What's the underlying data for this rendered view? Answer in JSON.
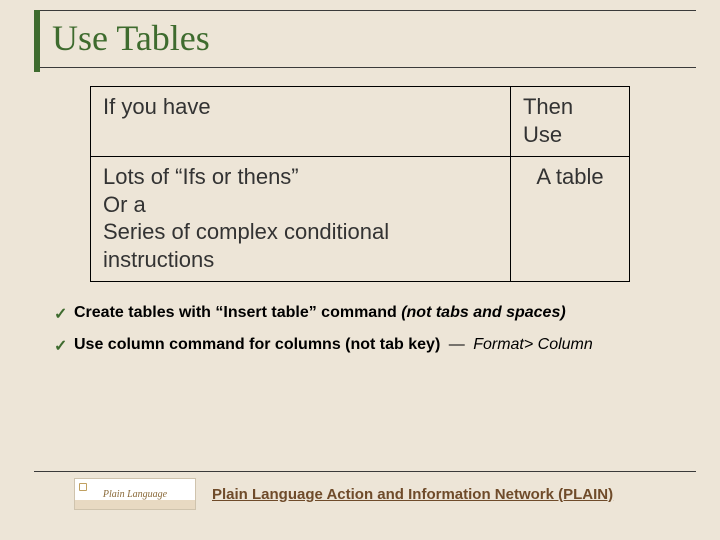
{
  "title": "Use Tables",
  "table": {
    "headers": [
      "If you have",
      "Then Use"
    ],
    "row": {
      "left_lines": [
        "Lots of “Ifs or thens”",
        "Or a",
        "Series of complex conditional instructions"
      ],
      "right": "A table"
    }
  },
  "tips": [
    {
      "check": "✓",
      "text_main": "Create tables with “Insert table” command ",
      "text_ital": "(not tabs and spaces)"
    },
    {
      "check": "✓",
      "text_main": "Use column command for columns (not tab key)",
      "dash": "—",
      "trail": "Format> Column"
    }
  ],
  "footer": {
    "logo_text": "Plain Language",
    "text": "Plain Language Action and Information Network (PLAIN)"
  }
}
